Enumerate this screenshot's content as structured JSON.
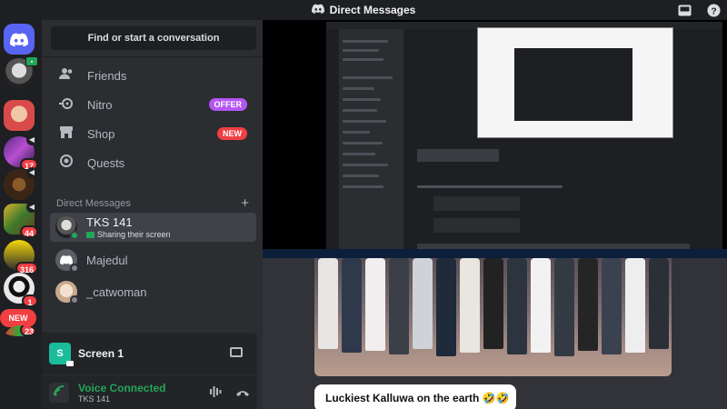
{
  "window": {
    "title": "Direct Messages"
  },
  "rail": {
    "badges": [
      "17",
      "44",
      "316",
      "1",
      "23"
    ],
    "new_label": "NEW"
  },
  "search": {
    "placeholder": "Find or start a conversation"
  },
  "nav": {
    "friends": "Friends",
    "nitro": "Nitro",
    "nitro_badge": "OFFER",
    "shop": "Shop",
    "shop_badge": "NEW",
    "quests": "Quests"
  },
  "dms": {
    "header": "Direct Messages",
    "items": [
      {
        "name": "TKS 141",
        "status": "Sharing their screen"
      },
      {
        "name": "Majedul",
        "status": ""
      },
      {
        "name": "_catwoman",
        "status": ""
      }
    ]
  },
  "screen_panel": {
    "label": "Screen 1"
  },
  "voice": {
    "status": "Voice Connected",
    "channel": "TKS 141"
  },
  "message": {
    "caption": "Luckiest Kalluwa on the earth 🤣🤣"
  },
  "colors": {
    "accent": "#5865f2",
    "online": "#23a559",
    "danger": "#f23f43",
    "nitro_pill": "#b455f2"
  },
  "icons": {
    "inbox": "inbox-icon",
    "help": "help-icon",
    "friends": "friends-icon",
    "nitro": "nitro-icon",
    "shop": "shop-icon",
    "quests": "quests-icon"
  }
}
